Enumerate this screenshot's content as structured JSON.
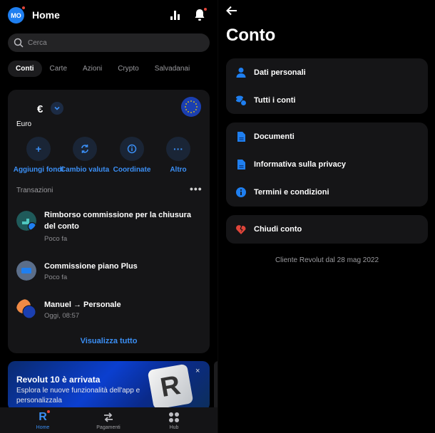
{
  "home": {
    "avatar_initials": "MO",
    "title": "Home",
    "search": {
      "placeholder": "Cerca",
      "value": ""
    },
    "tabs": [
      {
        "label": "Conti",
        "active": true
      },
      {
        "label": "Carte",
        "active": false
      },
      {
        "label": "Azioni",
        "active": false
      },
      {
        "label": "Crypto",
        "active": false
      },
      {
        "label": "Salvadanai",
        "active": false
      }
    ],
    "account": {
      "currency_symbol": "€",
      "currency_name": "Euro",
      "actions": [
        {
          "label": "Aggiungi fondi",
          "icon": "plus-icon"
        },
        {
          "label": "Cambio valuta",
          "icon": "exchange-icon"
        },
        {
          "label": "Coordinate",
          "icon": "info-icon"
        },
        {
          "label": "Altro",
          "icon": "more-icon"
        }
      ],
      "transactions_heading": "Transazioni",
      "transactions": [
        {
          "title": "Rimborso commissione per la chiusura del conto",
          "subtitle": "Poco fa"
        },
        {
          "title": "Commissione piano Plus",
          "subtitle": "Poco fa"
        },
        {
          "title": "Manuel → Personale",
          "subtitle": "Oggi, 08:57"
        }
      ],
      "view_all": "Visualizza tutto"
    },
    "banner": {
      "title": "Revolut 10 è arrivata",
      "subtitle": "Esplora le nuove funzionalità dell'app e personalizzala",
      "close": "×",
      "logo_letter": "R"
    },
    "bottom_nav": [
      {
        "label": "Home",
        "active": true
      },
      {
        "label": "Pagamenti",
        "active": false
      },
      {
        "label": "Hub",
        "active": false
      }
    ]
  },
  "account_page": {
    "title": "Conto",
    "group1": [
      {
        "label": "Dati personali",
        "icon": "person-icon"
      },
      {
        "label": "Tutti i conti",
        "icon": "accounts-icon"
      }
    ],
    "group2": [
      {
        "label": "Documenti",
        "icon": "document-icon"
      },
      {
        "label": "Informativa sulla privacy",
        "icon": "document-icon"
      },
      {
        "label": "Termini e condizioni",
        "icon": "info-icon"
      }
    ],
    "group3": [
      {
        "label": "Chiudi conto",
        "icon": "broken-heart-icon"
      }
    ],
    "footer": "Cliente Revolut dal 28 mag 2022"
  },
  "colors": {
    "accent": "#3b8ff5",
    "background": "#000000",
    "card": "#151517",
    "danger": "#e0453a"
  }
}
